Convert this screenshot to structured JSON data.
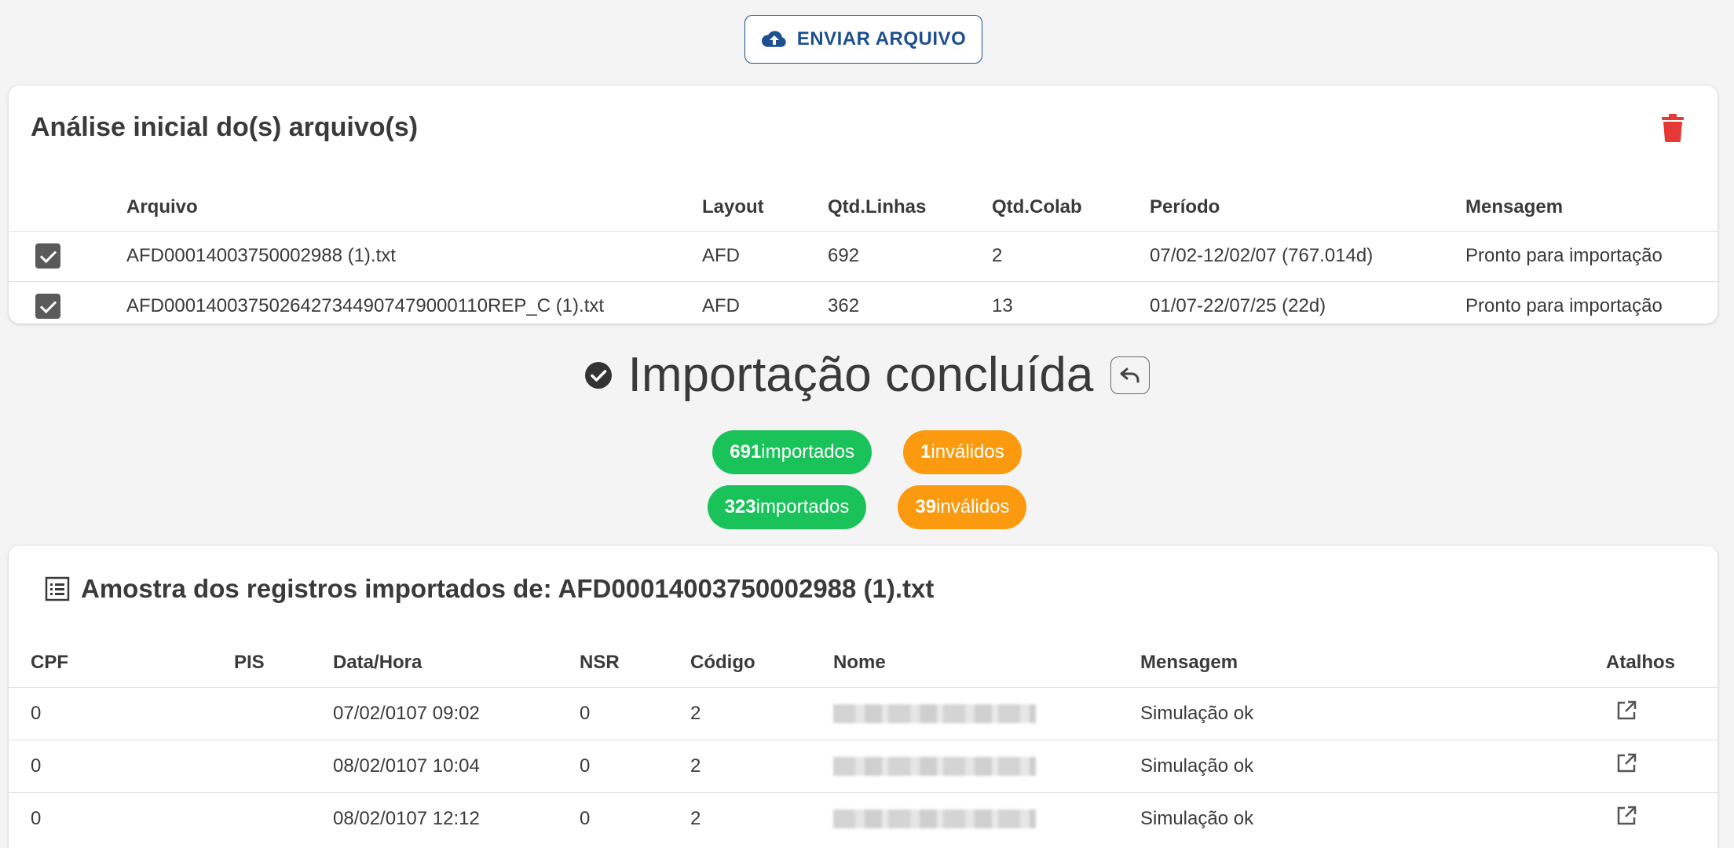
{
  "upload": {
    "label": "ENVIAR ARQUIVO"
  },
  "analysis": {
    "title": "Análise inicial do(s) arquivo(s)",
    "columns": [
      "Arquivo",
      "Layout",
      "Qtd.Linhas",
      "Qtd.Colab",
      "Período",
      "Mensagem"
    ],
    "rows": [
      {
        "arquivo": "AFD00014003750002988 (1).txt",
        "layout": "AFD",
        "linhas": "692",
        "colab": "2",
        "periodo": "07/02-12/02/07 (767.014d)",
        "mensagem": "Pronto para importação",
        "checked": true
      },
      {
        "arquivo": "AFD0001400375026427344907479000110REP_C (1).txt",
        "layout": "AFD",
        "linhas": "362",
        "colab": "13",
        "periodo": "01/07-22/07/25 (22d)",
        "mensagem": "Pronto para importação",
        "checked": true
      }
    ]
  },
  "status": {
    "title": "Importação concluída",
    "badges": [
      {
        "imported_count": "691",
        "imported_label": "importados",
        "invalid_count": "1",
        "invalid_label": "inválidos"
      },
      {
        "imported_count": "323",
        "imported_label": "importados",
        "invalid_count": "39",
        "invalid_label": "inválidos"
      }
    ]
  },
  "sample": {
    "title": "Amostra dos registros importados de: AFD00014003750002988 (1).txt",
    "columns": [
      "CPF",
      "PIS",
      "Data/Hora",
      "NSR",
      "Código",
      "Nome",
      "Mensagem",
      "Atalhos"
    ],
    "rows": [
      {
        "cpf": "0",
        "pis": "",
        "datahora": "07/02/0107 09:02",
        "nsr": "0",
        "codigo": "2",
        "mensagem": "Simulação ok"
      },
      {
        "cpf": "0",
        "pis": "",
        "datahora": "08/02/0107 10:04",
        "nsr": "0",
        "codigo": "2",
        "mensagem": "Simulação ok"
      },
      {
        "cpf": "0",
        "pis": "",
        "datahora": "08/02/0107 12:12",
        "nsr": "0",
        "codigo": "2",
        "mensagem": "Simulação ok"
      }
    ]
  },
  "colors": {
    "primary": "#1d4f91",
    "success": "#19c35a",
    "warning": "#fb9a0f",
    "danger": "#e53935"
  },
  "icons": [
    "cloud-upload-icon",
    "trash-icon",
    "check-circle-icon",
    "undo-icon",
    "list-icon",
    "open-external-icon"
  ]
}
